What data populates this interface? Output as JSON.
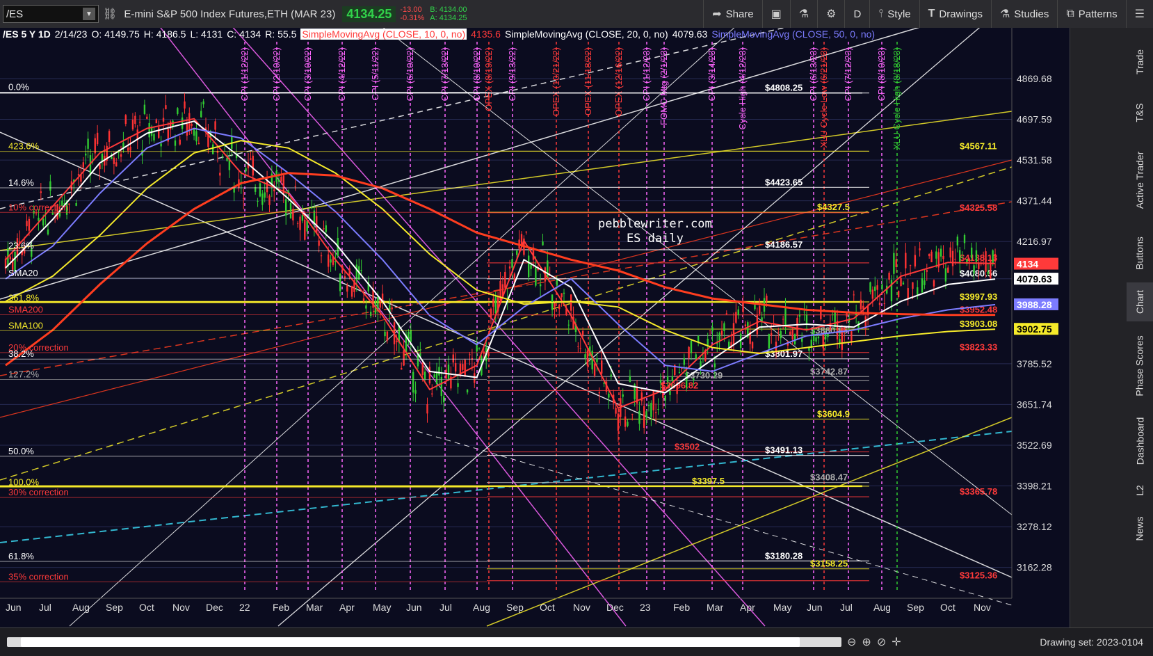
{
  "toolbar": {
    "symbol": "/ES",
    "instrument": "E-mini S&P 500 Index Futures,ETH (MAR 23)",
    "last": "4134.25",
    "change": "-13.00",
    "change_pct": "-0.31%",
    "bid": "B: 4134.00",
    "ask": "A: 4134.25",
    "share": "Share",
    "period": "D",
    "style": "Style",
    "drawings": "Drawings",
    "studies": "Studies",
    "patterns": "Patterns"
  },
  "header": {
    "info": "/ES 5 Y 1D",
    "date": "2/14/23",
    "open": "O: 4149.75",
    "high": "H: 4186.5",
    "low": "L: 4131",
    "close": "C: 4134",
    "range": "R: 55.5",
    "sma10_label": "SimpleMovingAvg (CLOSE, 10, 0, no)",
    "sma10_value": "4135.6",
    "sma20_label": "SimpleMovingAvg (CLOSE, 20, 0, no)",
    "sma20_value": "4079.63",
    "sma50_label": "SimpleMovingAvg (CLOSE, 50, 0, no)"
  },
  "watermark": {
    "line1": "pebblewriter.com",
    "line2": "ES daily"
  },
  "sidebar_tabs": [
    "Trade",
    "T&S",
    "Active Trader",
    "Buttons",
    "Chart",
    "Phase Scores",
    "Dashboard",
    "L2",
    "News"
  ],
  "status": {
    "drawing_set": "Drawing set: 2023-0104"
  },
  "colors": {
    "background": "#0b0c1f",
    "grid": "#2a2e55",
    "sma10": "#ff3a3a",
    "sma20": "#ffffff",
    "sma50": "#7c7cff",
    "yellow": "#f5ea2a",
    "magenta": "#ff66ff",
    "cyan": "#3ad6f0",
    "orange_red": "#ff3d1f",
    "up": "#32cd32",
    "down": "#ff3333"
  },
  "chart_data": {
    "type": "line",
    "title": "/ES 5 Y 1D",
    "x_tick_labels": [
      "Jun",
      "Jul",
      "Aug",
      "Sep",
      "Oct",
      "Nov",
      "Dec",
      "22",
      "Feb",
      "Mar",
      "Apr",
      "May",
      "Jun",
      "Jul",
      "Aug",
      "Sep",
      "Oct",
      "Nov",
      "Dec",
      "23",
      "Feb",
      "Mar",
      "Apr",
      "May",
      "Jun",
      "Jul",
      "Aug",
      "Sep",
      "Oct",
      "Nov"
    ],
    "y_ticks": [
      "4869.68",
      "4697.59",
      "4531.58",
      "4371.44",
      "4216.97",
      "4080.56",
      "3785.52",
      "3651.74",
      "3522.69",
      "3398.21",
      "3278.12",
      "3162.28"
    ],
    "ylim": [
      3100,
      5000
    ],
    "log_scale": true,
    "grid": true,
    "price_badges": [
      {
        "value": "4134",
        "color": "#ff3a3a"
      },
      {
        "value": "4079.63",
        "color": "#ffffff"
      },
      {
        "value": "3988.28",
        "color": "#7c7cff"
      },
      {
        "value": "3902.75",
        "color": "#f5ea2a"
      }
    ],
    "series": [
      {
        "name": "SMA10",
        "color": "#ff3a3a",
        "x": [
          0,
          20,
          40,
          60,
          80,
          100,
          120,
          140,
          160,
          180,
          200,
          220,
          240,
          260,
          280,
          300,
          320,
          340,
          360,
          380,
          400,
          420
        ],
        "values": [
          4150,
          4350,
          4560,
          4660,
          4700,
          4480,
          4400,
          4150,
          3950,
          3700,
          3780,
          4220,
          3950,
          3640,
          3700,
          3850,
          3930,
          3900,
          3940,
          4090,
          4140,
          4135.6
        ]
      },
      {
        "name": "SMA20",
        "color": "#ffffff",
        "x": [
          0,
          20,
          40,
          60,
          80,
          100,
          120,
          140,
          160,
          180,
          200,
          220,
          240,
          260,
          280,
          300,
          320,
          340,
          360,
          380,
          400,
          420
        ],
        "values": [
          4120,
          4300,
          4520,
          4640,
          4690,
          4540,
          4380,
          4210,
          4000,
          3760,
          3740,
          4150,
          4050,
          3720,
          3690,
          3800,
          3910,
          3920,
          3910,
          4000,
          4060,
          4079.63
        ]
      },
      {
        "name": "SMA50",
        "color": "#7c7cff",
        "x": [
          0,
          20,
          40,
          60,
          80,
          100,
          120,
          140,
          160,
          180,
          200,
          220,
          240,
          260,
          280,
          300,
          320,
          340,
          360,
          380,
          400,
          420
        ],
        "values": [
          4080,
          4200,
          4400,
          4580,
          4660,
          4620,
          4480,
          4330,
          4150,
          3950,
          3850,
          3980,
          4080,
          3920,
          3780,
          3760,
          3820,
          3880,
          3900,
          3940,
          3970,
          3988.28
        ]
      },
      {
        "name": "SMA100",
        "color": "#f5ea2a",
        "x": [
          0,
          20,
          40,
          60,
          80,
          100,
          120,
          140,
          160,
          180,
          200,
          220,
          240,
          260,
          280,
          300,
          320,
          340,
          360,
          380,
          400,
          420
        ],
        "values": [
          4000,
          4090,
          4240,
          4420,
          4560,
          4610,
          4580,
          4480,
          4340,
          4170,
          4040,
          3990,
          4000,
          3980,
          3900,
          3840,
          3820,
          3840,
          3860,
          3880,
          3895,
          3902.75
        ]
      },
      {
        "name": "SMA200",
        "color": "#ff3d1f",
        "x": [
          0,
          20,
          40,
          60,
          80,
          100,
          120,
          140,
          160,
          180,
          200,
          220,
          240,
          260,
          280,
          300,
          320,
          340,
          360,
          380,
          400,
          420
        ],
        "values": [
          3780,
          3900,
          4060,
          4210,
          4340,
          4440,
          4480,
          4470,
          4420,
          4340,
          4250,
          4200,
          4150,
          4110,
          4050,
          4010,
          3990,
          3970,
          3960,
          3955,
          3952,
          3952.48
        ]
      }
    ],
    "horizontal_levels": [
      {
        "value": 4808.25,
        "label": "$4808.25",
        "color": "#ffffff"
      },
      {
        "value": 4567.11,
        "label": "$4567.11",
        "color": "#f5ea2a"
      },
      {
        "value": 4423.65,
        "label": "$4423.65",
        "color": "#ffffff"
      },
      {
        "value": 4327.5,
        "label": "$4327.5",
        "color": "#f5ea2a"
      },
      {
        "value": 4325.58,
        "label": "$4325.58",
        "color": "#ff3a3a"
      },
      {
        "value": 4186.57,
        "label": "$4186.57",
        "color": "#ffffff"
      },
      {
        "value": 4138.13,
        "label": "$4138.13",
        "color": "#ff3a3a"
      },
      {
        "value": 4080.56,
        "label": "$4080.56",
        "color": "#ffffff"
      },
      {
        "value": 3997.93,
        "label": "$3997.93",
        "color": "#f5ea2a"
      },
      {
        "value": 3952.48,
        "label": "$3952.48",
        "color": "#ff3a3a"
      },
      {
        "value": 3903.08,
        "label": "$3903.08",
        "color": "#f5ea2a"
      },
      {
        "value": 3880.85,
        "label": "$3880.85",
        "color": "#aaaaaa"
      },
      {
        "value": 3823.33,
        "label": "$3823.33",
        "color": "#ff3a3a"
      },
      {
        "value": 3801.97,
        "label": "$3801.97",
        "color": "#ffffff"
      },
      {
        "value": 3742.87,
        "label": "$3742.87",
        "color": "#aaaaaa"
      },
      {
        "value": 3730.29,
        "label": "$3730.29",
        "color": "#aaaaaa"
      },
      {
        "value": 3696.82,
        "label": "$3696.82",
        "color": "#ff3a3a"
      },
      {
        "value": 3604.9,
        "label": "$3604.9",
        "color": "#f5ea2a"
      },
      {
        "value": 3502,
        "label": "$3502",
        "color": "#ff3a3a"
      },
      {
        "value": 3491.13,
        "label": "$3491.13",
        "color": "#ffffff"
      },
      {
        "value": 3408.47,
        "label": "$3408.47",
        "color": "#aaaaaa"
      },
      {
        "value": 3397.5,
        "label": "$3397.5",
        "color": "#f5ea2a"
      },
      {
        "value": 3365.78,
        "label": "$3365.78",
        "color": "#ff3a3a"
      },
      {
        "value": 3180.28,
        "label": "$3180.28",
        "color": "#ffffff"
      },
      {
        "value": 3158.25,
        "label": "$3158.25",
        "color": "#f5ea2a"
      },
      {
        "value": 3125.36,
        "label": "$3125.36",
        "color": "#ff3a3a"
      }
    ],
    "fib_labels": [
      {
        "text": "0.0%",
        "value": 4820,
        "color": "#ffffff"
      },
      {
        "text": "423.6%",
        "value": 4575,
        "color": "#f5ea2a"
      },
      {
        "text": "14.6%",
        "value": 4430,
        "color": "#ffffff"
      },
      {
        "text": "10% correction",
        "value": 4335,
        "color": "#ff3a3a"
      },
      {
        "text": "23.6%",
        "value": 4190,
        "color": "#ffffff"
      },
      {
        "text": "SMA20",
        "value": 4090,
        "color": "#ffffff"
      },
      {
        "text": "361.8%",
        "value": 4002,
        "color": "#f5ea2a"
      },
      {
        "text": "SMA200",
        "value": 3960,
        "color": "#ff3a3a"
      },
      {
        "text": "SMA100",
        "value": 3905,
        "color": "#f5ea2a"
      },
      {
        "text": "20% correction",
        "value": 3830,
        "color": "#ff3a3a"
      },
      {
        "text": "38.2%",
        "value": 3808,
        "color": "#ffffff"
      },
      {
        "text": "127.2%",
        "value": 3740,
        "color": "#aaaaaa"
      },
      {
        "text": "50.0%",
        "value": 3495,
        "color": "#ffffff"
      },
      {
        "text": "100.0%",
        "value": 3400,
        "color": "#f5ea2a"
      },
      {
        "text": "30% correction",
        "value": 3370,
        "color": "#ff3a3a"
      },
      {
        "text": "61.8%",
        "value": 3185,
        "color": "#ffffff"
      },
      {
        "text": "35% correction",
        "value": 3128,
        "color": "#ff3a3a"
      }
    ],
    "event_labels": [
      {
        "text": "CPI (1/12/22)",
        "color": "#ff66ff"
      },
      {
        "text": "CPI (2/10/22)",
        "color": "#ff66ff"
      },
      {
        "text": "CPI (3/10/22)",
        "color": "#ff66ff"
      },
      {
        "text": "CPI (4/12/22)",
        "color": "#ff66ff"
      },
      {
        "text": "CPI (5/11/22)",
        "color": "#ff66ff"
      },
      {
        "text": "CPI (6/10/22)",
        "color": "#ff66ff"
      },
      {
        "text": "CPI (7/13/22)",
        "color": "#ff66ff"
      },
      {
        "text": "CPI (8/10/22)",
        "color": "#ff66ff"
      },
      {
        "text": "OPEX (8/19/22)",
        "color": "#ff3a3a"
      },
      {
        "text": "CPI (9/13/22)",
        "color": "#ff66ff"
      },
      {
        "text": "OPEX (10/21/22)",
        "color": "#ff3a3a"
      },
      {
        "text": "OPEX (11/18/22)",
        "color": "#ff3a3a"
      },
      {
        "text": "OPEX (12/16/22)",
        "color": "#ff3a3a"
      },
      {
        "text": "CPI (1/12/23)",
        "color": "#ff66ff"
      },
      {
        "text": "FOMC Mtg (2/1/23)",
        "color": "#ff66ff"
      },
      {
        "text": "CPI (3/14/23)",
        "color": "#ff66ff"
      },
      {
        "text": "Cycle High (4/12/23)",
        "color": "#ff66ff"
      },
      {
        "text": "CPI (6/13/23)",
        "color": "#ff66ff"
      },
      {
        "text": "XLU Cycle Low (6/21/23)",
        "color": "#ff3a3a"
      },
      {
        "text": "CPI (7/12/23)",
        "color": "#ff66ff"
      },
      {
        "text": "CPI (8/10/23)",
        "color": "#ff66ff"
      },
      {
        "text": "XLU Cycle High (8/18/23)",
        "color": "#32cd32"
      }
    ]
  }
}
